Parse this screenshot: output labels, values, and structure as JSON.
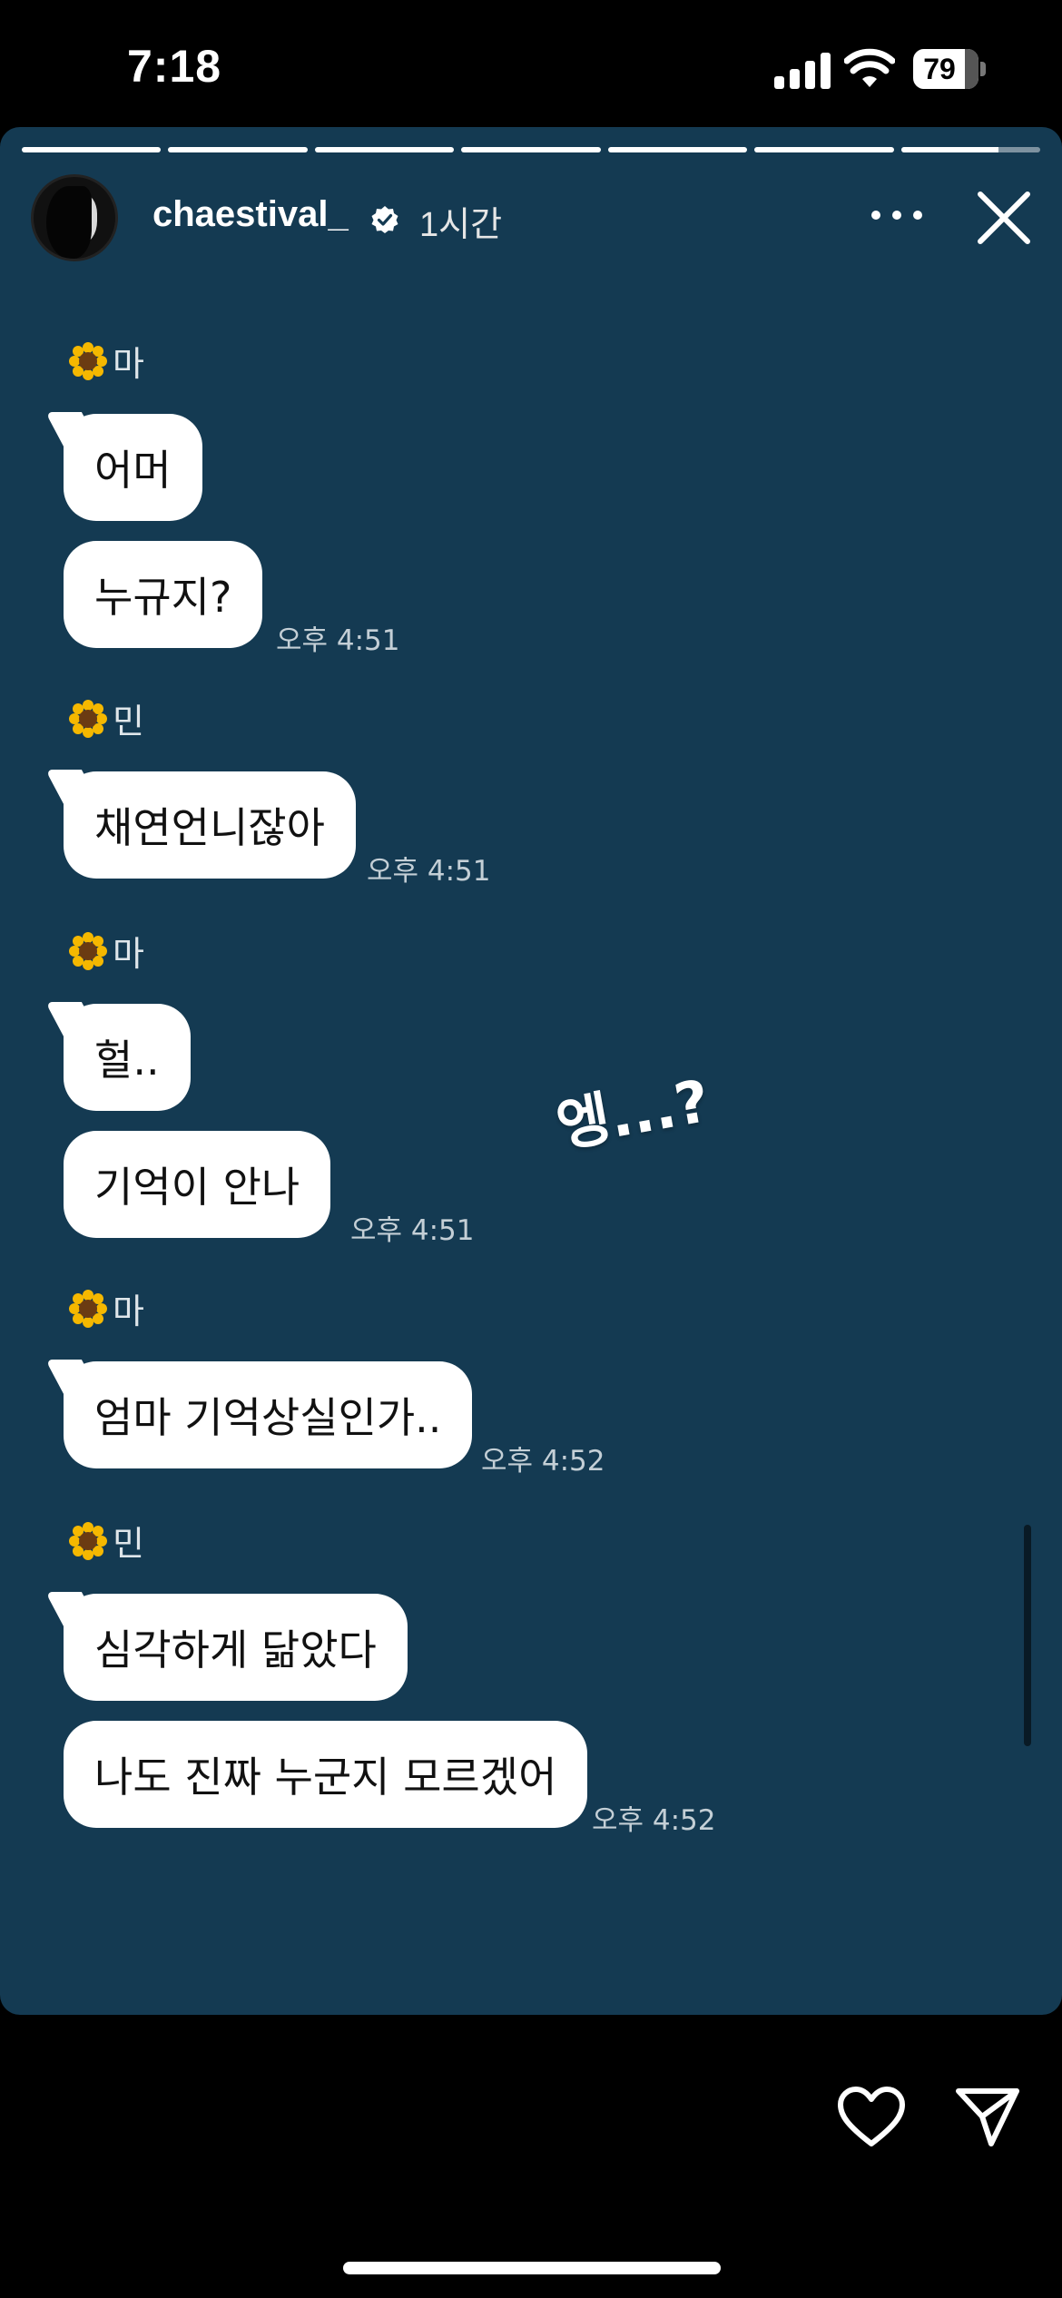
{
  "status_bar": {
    "time": "7:18",
    "battery": "79",
    "battery_level": 0.79
  },
  "story": {
    "username": "chaestival_",
    "time_ago": "1시간",
    "progress_segments": [
      1,
      1,
      1,
      1,
      1,
      1,
      0.7
    ]
  },
  "chat": {
    "groups": [
      {
        "sender": "마",
        "messages": [
          "어머",
          "누규지?"
        ],
        "time": "오후 4:51"
      },
      {
        "sender": "민",
        "messages": [
          "채연언니잖아"
        ],
        "time": "오후 4:51"
      },
      {
        "sender": "마",
        "messages": [
          "헐..",
          "기억이 안나"
        ],
        "time": "오후 4:51"
      },
      {
        "sender": "마",
        "messages": [
          "엄마 기억상실인가.."
        ],
        "time": "오후 4:52"
      },
      {
        "sender": "민",
        "messages": [
          "심각하게 닮았다",
          "나도 진짜 누군지 모르겠어"
        ],
        "time": "오후 4:52"
      }
    ]
  },
  "sticker_text": "엥...?",
  "icons": {
    "verified": "verified-badge-icon",
    "more": "more-options-icon",
    "close": "close-icon",
    "like": "heart-icon",
    "share": "send-icon",
    "emoji": "sunflower-icon"
  }
}
